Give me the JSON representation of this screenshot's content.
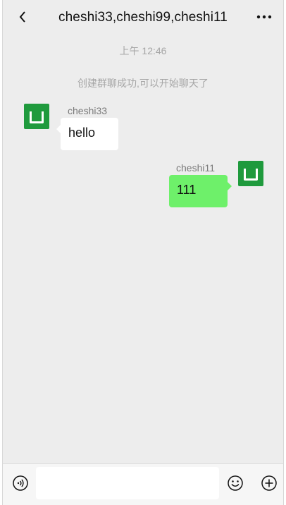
{
  "header": {
    "title": "cheshi33,cheshi99,cheshi11",
    "back_icon": "chevron-left-icon",
    "more_icon": "more-dots-icon"
  },
  "chat": {
    "timestamp": "上午 12:46",
    "system_message": "创建群聊成功,可以开始聊天了",
    "messages": [
      {
        "sender": "cheshi33",
        "text": "hello",
        "side": "left",
        "bubble_color": "#ffffff"
      },
      {
        "sender": "cheshi11",
        "text": "111",
        "side": "right",
        "bubble_color": "#6ef06a"
      }
    ],
    "avatar_color": "#1f9a3d"
  },
  "input_bar": {
    "value": "",
    "placeholder": "",
    "voice_icon": "voice-icon",
    "emoji_icon": "emoji-icon",
    "plus_icon": "plus-icon"
  }
}
